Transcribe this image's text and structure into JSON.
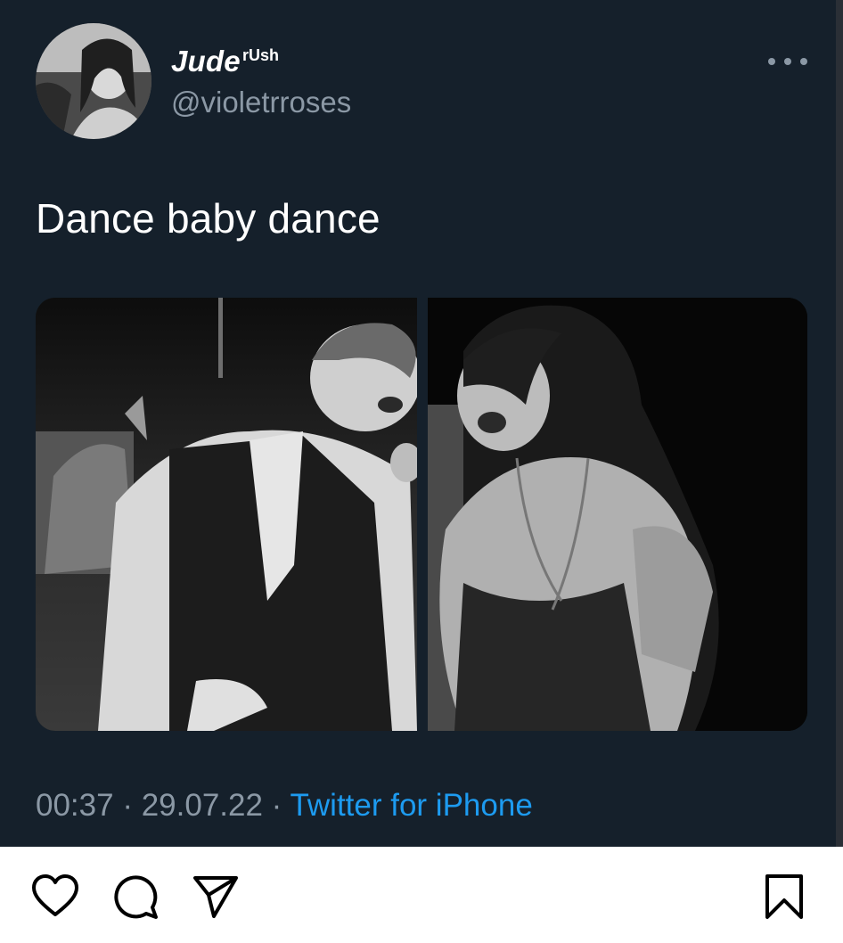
{
  "tweet": {
    "author": {
      "display_name": "Jude",
      "name_suffix": "rUsh",
      "handle": "@violetrroses"
    },
    "text": "Dance baby dance",
    "media": [
      {
        "description_icon": "photo-grayscale-man-dancing"
      },
      {
        "description_icon": "photo-grayscale-woman-laughing"
      }
    ],
    "time": "00:37",
    "date": "29.07.22",
    "separator": " · ",
    "source": "Twitter for iPhone"
  },
  "actions": {
    "like_icon": "heart-icon",
    "comment_icon": "comment-bubble-icon",
    "share_icon": "send-arrow-icon",
    "save_icon": "bookmark-icon"
  },
  "colors": {
    "background": "#15202b",
    "text_primary": "#ffffff",
    "text_secondary": "#8b98a5",
    "link": "#1d9bf0"
  }
}
